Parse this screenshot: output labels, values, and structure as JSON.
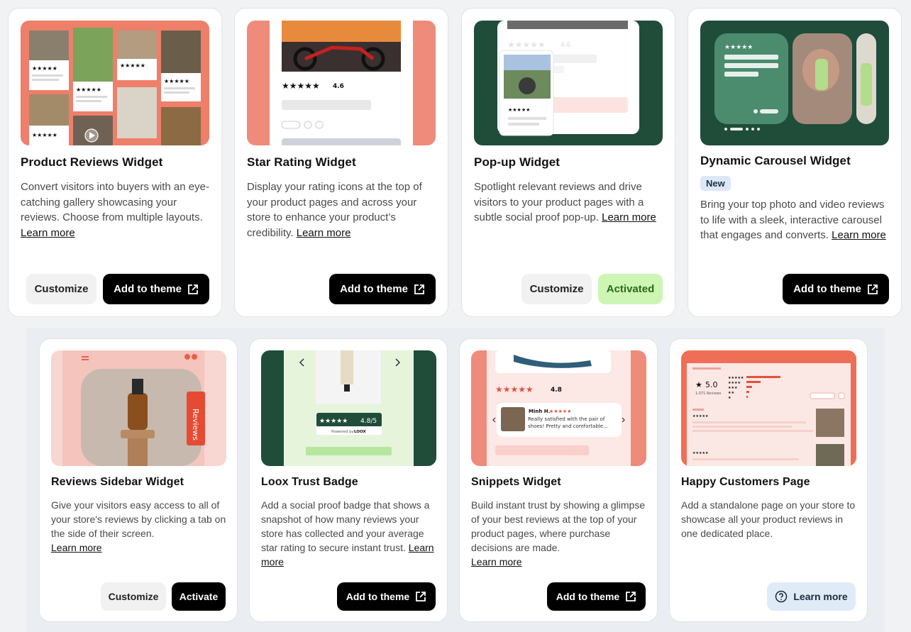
{
  "row1": [
    {
      "title": "Product Reviews Widget",
      "desc": "Convert visitors into buyers with an eye-catching gallery showcasing your reviews. Choose from multiple layouts.",
      "link": "Learn more",
      "customize": "Customize",
      "add": "Add to theme"
    },
    {
      "title": "Star Rating Widget",
      "desc": "Display your rating icons at the top of your product pages and across your store to enhance your product’s credibility.",
      "link": "Learn more",
      "add": "Add to theme",
      "thumb_rating": "4.6"
    },
    {
      "title": "Pop-up Widget",
      "desc": "Spotlight relevant reviews and drive visitors to your product pages with a subtle social proof pop-up.",
      "link": "Learn more",
      "customize": "Customize",
      "activated": "Activated",
      "thumb_rating": "4.6"
    },
    {
      "title": "Dynamic Carousel Widget",
      "badge": "New",
      "desc": "Bring your top photo and video reviews to life with a sleek, interactive carousel that engages and converts.",
      "link": "Learn more",
      "add": "Add to theme"
    }
  ],
  "row2": [
    {
      "title": "Reviews Sidebar Widget",
      "desc": "Give your visitors easy access to all of your store's reviews by clicking a tab on the side of their screen.",
      "link": "Learn more",
      "customize": "Customize",
      "activate": "Activate",
      "thumb_tab": "Reviews"
    },
    {
      "title": "Loox Trust Badge",
      "desc": "Add a social proof badge that shows a snapshot of how many reviews your store has collected and your average star rating to secure instant trust.",
      "link": "Learn more",
      "add": "Add to theme",
      "thumb_rating": "4.8/5",
      "thumb_powered": "Powered by",
      "thumb_brand": "LOOX"
    },
    {
      "title": "Snippets Widget",
      "desc": "Build instant trust by showing a glimpse of your best reviews at the top of your product pages, where purchase decisions are made.",
      "link": "Learn more",
      "add": "Add to theme",
      "thumb_rating": "4.8",
      "thumb_author": "Minh H.",
      "thumb_quote": "Really satisfied with the pair of shoes! Pretty and comfortable..."
    },
    {
      "title": "Happy Customers Page",
      "desc": "Add a standalone page on your store to showcase all your product reviews in one dedicated place.",
      "learn": "Learn more",
      "thumb_rating": "5.0",
      "thumb_count": "1,071 Reviews"
    }
  ],
  "colors": {
    "coral": "#ee8b7a",
    "dark_green": "#1f4d3a",
    "activated_bg": "#cdf5b3"
  }
}
